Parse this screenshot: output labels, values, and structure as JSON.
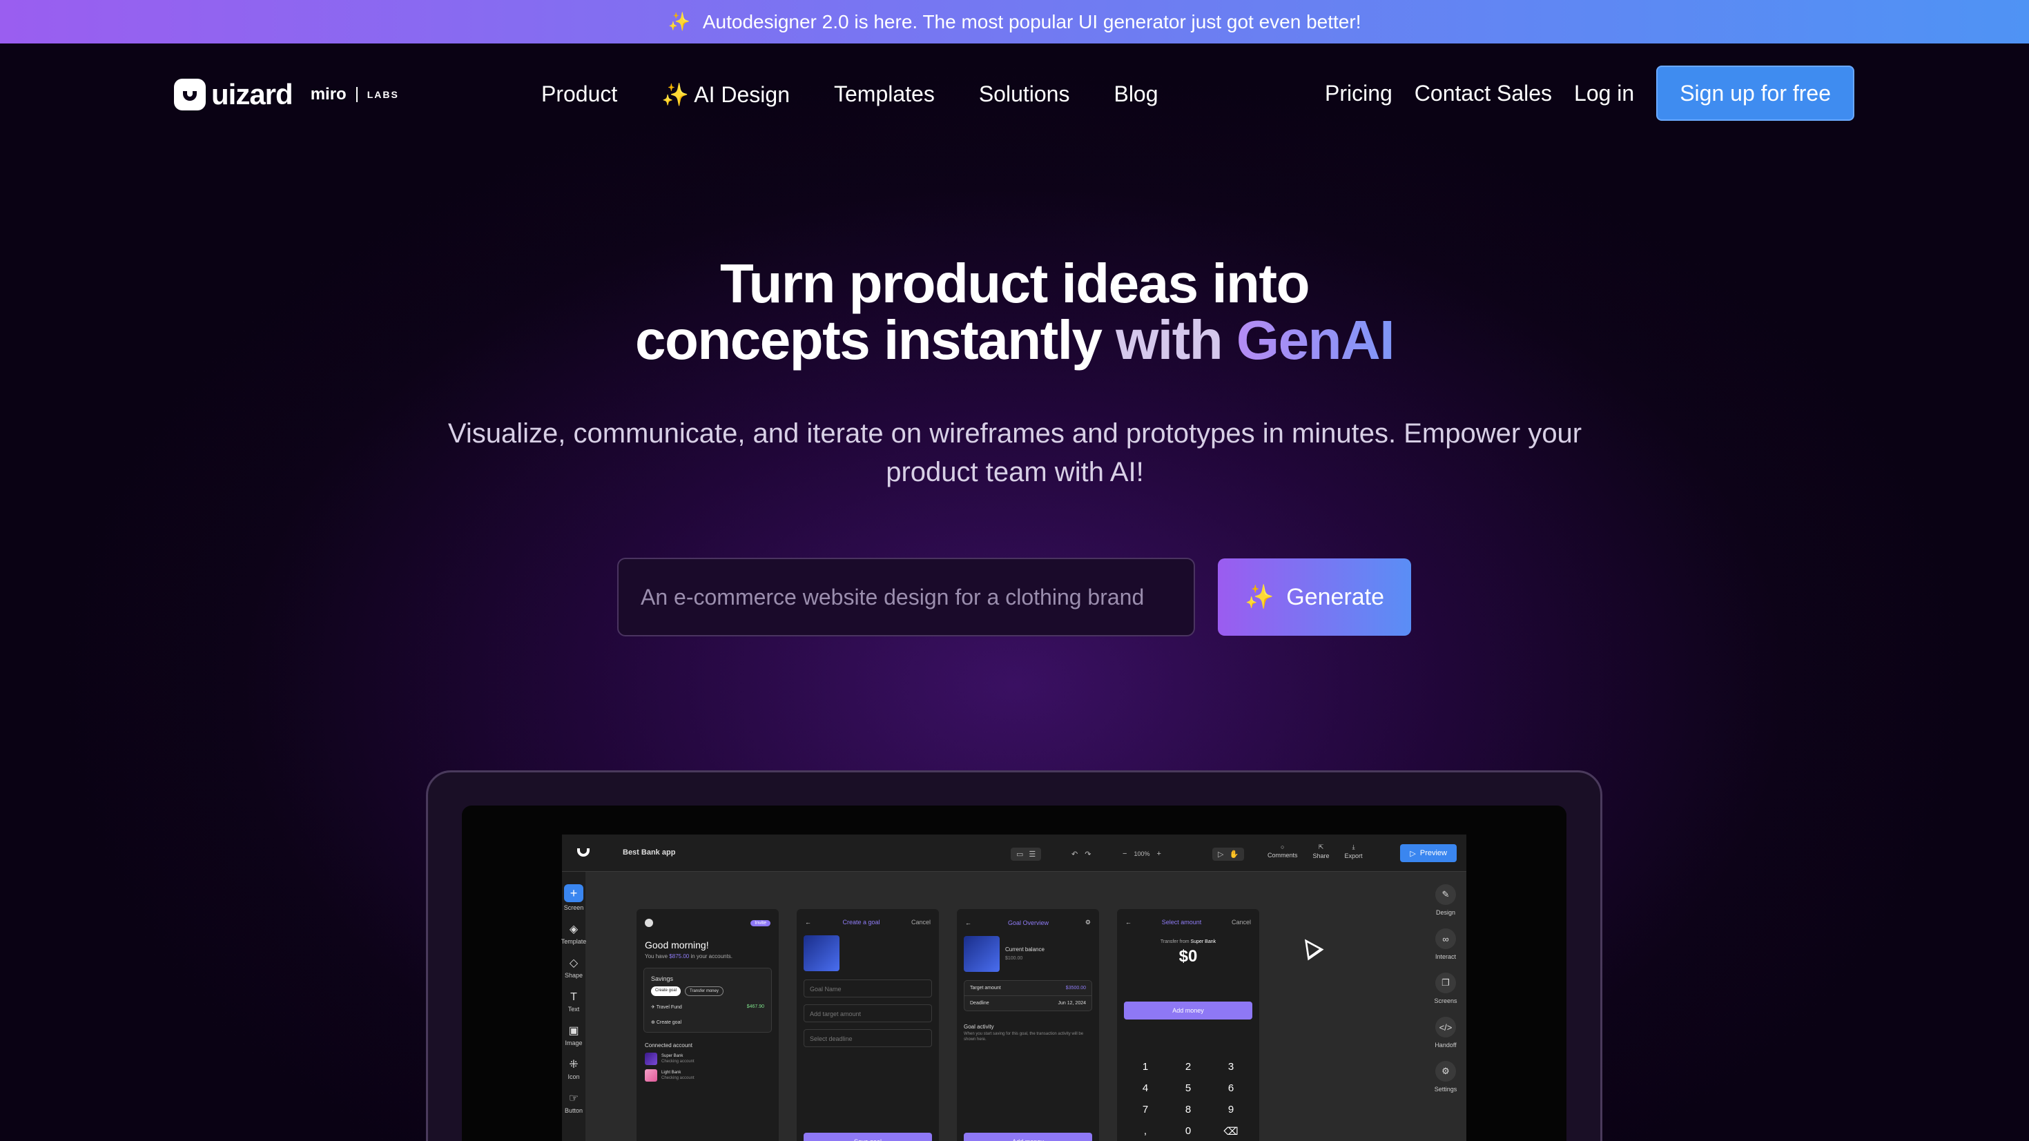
{
  "banner": {
    "spark_icon": "sparkles-icon",
    "spark_glyph": "✨",
    "text": "Autodesigner 2.0 is here. The most popular UI generator just got even better!"
  },
  "header": {
    "logo_text": "uizard",
    "logo_partner": "miro",
    "logo_sub": "LABS",
    "nav": [
      "Product",
      "AI Design",
      "Templates",
      "Solutions",
      "Blog"
    ],
    "ai_design_glyph": "✨",
    "right_links": [
      "Pricing",
      "Contact Sales",
      "Log in"
    ],
    "signup_label": "Sign up for free"
  },
  "hero": {
    "title_line1": "Turn product ideas into",
    "title_line2_a": "concepts instantly ",
    "title_line2_b": "with ",
    "title_line2_c": "GenAI",
    "subtitle": "Visualize, communicate, and iterate on wireframes and prototypes in minutes. Empower your product team with AI!",
    "input_placeholder": "An e-commerce website design for a clothing brand",
    "generate_glyph": "✨",
    "generate_label": "Generate"
  },
  "colors": {
    "banner_start": "#9a5ef0",
    "banner_end": "#4f93f4",
    "signup": "#3f8cf0",
    "generate_start": "#9b5cf0",
    "generate_end": "#5a8ef5",
    "accent_purple": "#8e78f5"
  },
  "editor": {
    "project_name": "Best Bank app",
    "zoom": "100%",
    "top_actions": [
      "Comments",
      "Share",
      "Export"
    ],
    "preview_label": "Preview",
    "left_tools": [
      "Screen",
      "Template",
      "Shape",
      "Text",
      "Image",
      "Icon",
      "Button"
    ],
    "right_tools": [
      "Design",
      "Interact",
      "Screens",
      "Handoff",
      "Settings"
    ],
    "screen1": {
      "badge": "Invite",
      "greeting": "Good morning!",
      "balance_prefix": "You have ",
      "balance": "$875.00",
      "balance_suffix": " in your accounts.",
      "savings_title": "Savings",
      "pills": [
        "Create goal",
        "Transfer money"
      ],
      "goal_name": "Travel Fund",
      "goal_amount": "$467.90",
      "create_goal": "Create goal",
      "connected_title": "Connected account",
      "accounts": [
        {
          "name": "Super Bank",
          "type": "Checking account"
        },
        {
          "name": "Light Bank",
          "type": "Checking account"
        }
      ]
    },
    "screen2": {
      "title": "Create a goal",
      "cancel": "Cancel",
      "fields": [
        "Goal Name",
        "Add target amount",
        "Select deadline"
      ],
      "button": "Save goal"
    },
    "screen3": {
      "title": "Goal Overview",
      "balance_label": "Current balance",
      "balance_value": "$100.00",
      "target_label": "Target amount",
      "target_value": "$3500.00",
      "deadline_label": "Deadline",
      "deadline_value": "Jun 12, 2024",
      "activity_title": "Goal activity",
      "activity_text": "When you start saving for this goal, the transaction activity will be shown here.",
      "button": "Add money"
    },
    "screen4": {
      "title": "Select amount",
      "cancel": "Cancel",
      "transfer_prefix": "Transfer from ",
      "transfer_bank": "Super Bank",
      "amount": "$0",
      "button": "Add money",
      "keys": [
        "1",
        "2",
        "3",
        "4",
        "5",
        "6",
        "7",
        "8",
        "9",
        ",",
        "0",
        "⌫"
      ]
    }
  }
}
